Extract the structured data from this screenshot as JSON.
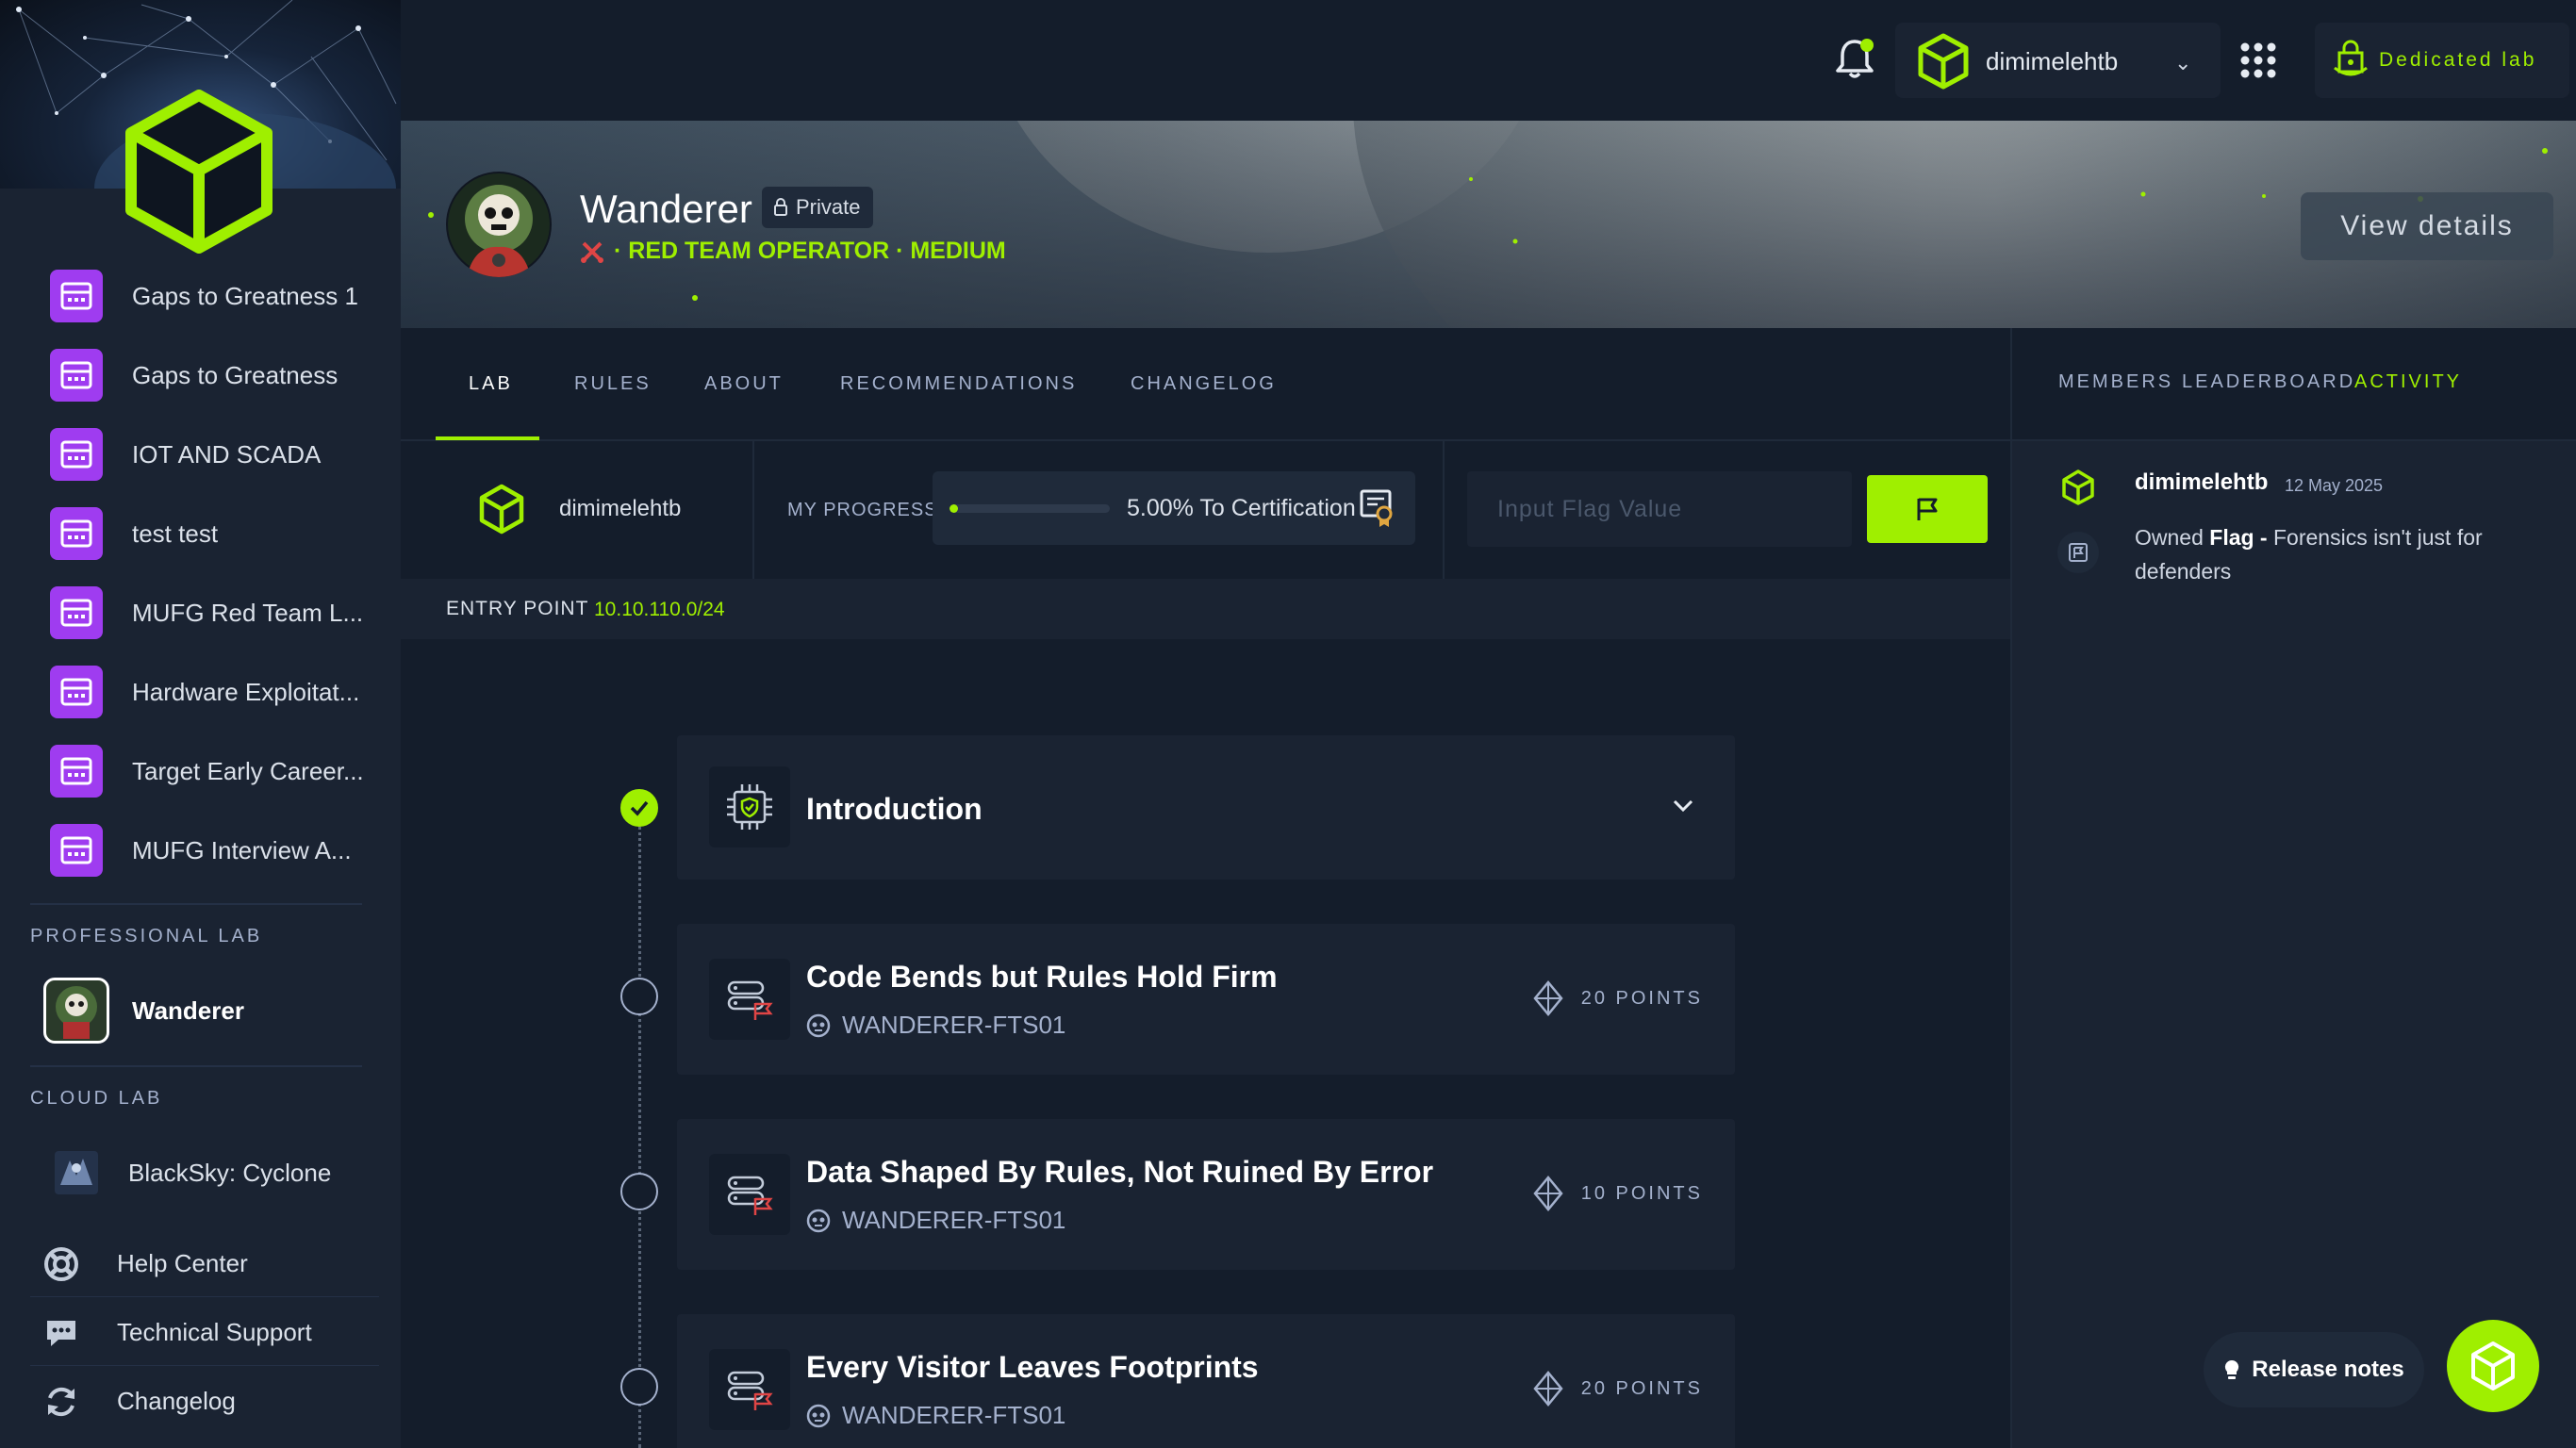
{
  "sidebar": {
    "items": [
      {
        "label": "Gaps to Greatness 1"
      },
      {
        "label": "Gaps to Greatness"
      },
      {
        "label": "IOT AND SCADA"
      },
      {
        "label": "test test"
      },
      {
        "label": "MUFG Red Team L..."
      },
      {
        "label": "Hardware Exploitat..."
      },
      {
        "label": "Target Early Career..."
      },
      {
        "label": "MUFG Interview A..."
      }
    ],
    "professional_lab_heading": "PROFESSIONAL LAB",
    "professional_lab": {
      "label": "Wanderer"
    },
    "cloud_lab_heading": "CLOUD LAB",
    "cloud_lab": {
      "label": "BlackSky: Cyclone"
    },
    "footer": [
      {
        "label": "Help Center",
        "icon": "lifebuoy-icon"
      },
      {
        "label": "Technical Support",
        "icon": "chat-icon"
      },
      {
        "label": "Changelog",
        "icon": "refresh-icon"
      }
    ]
  },
  "topbar": {
    "username": "dimimelehtb",
    "dedicated_lab": "Dedicated lab"
  },
  "hero": {
    "title": "Wanderer",
    "private_badge": "Private",
    "subtitle": "· RED TEAM OPERATOR · MEDIUM",
    "view_details": "View details"
  },
  "tabs": [
    "LAB",
    "RULES",
    "ABOUT",
    "RECOMMENDATIONS",
    "CHANGELOG"
  ],
  "side_tabs": [
    "MEMBERS",
    "LEADERBOARD",
    "ACTIVITY"
  ],
  "progress": {
    "user": "dimimelehtb",
    "label": "MY PROGRESS",
    "value": 0.05,
    "text": "5.00% To Certification",
    "flag_placeholder": "Input Flag Value"
  },
  "entry_point": {
    "label": "ENTRY POINT",
    "value": "10.10.110.0/24"
  },
  "flags": [
    {
      "title": "Introduction",
      "completed": true
    },
    {
      "title": "Code Bends but Rules Hold Firm",
      "machine": "WANDERER-FTS01",
      "points": "20 POINTS",
      "completed": false
    },
    {
      "title": "Data Shaped By Rules, Not Ruined By Error",
      "machine": "WANDERER-FTS01",
      "points": "10 POINTS",
      "completed": false
    },
    {
      "title": "Every Visitor Leaves Footprints",
      "machine": "WANDERER-FTS01",
      "points": "20 POINTS",
      "completed": false
    }
  ],
  "activity": {
    "user": "dimimelehtb",
    "date": "12 May 2025",
    "prefix": "Owned ",
    "strong": "Flag -",
    "rest": " Forensics isn't just for defenders"
  },
  "floating": {
    "release_notes": "Release notes"
  },
  "colors": {
    "accent": "#9fef00",
    "bg": "#141d2b",
    "panel": "#1a2332",
    "purple": "#9f3cf0"
  }
}
